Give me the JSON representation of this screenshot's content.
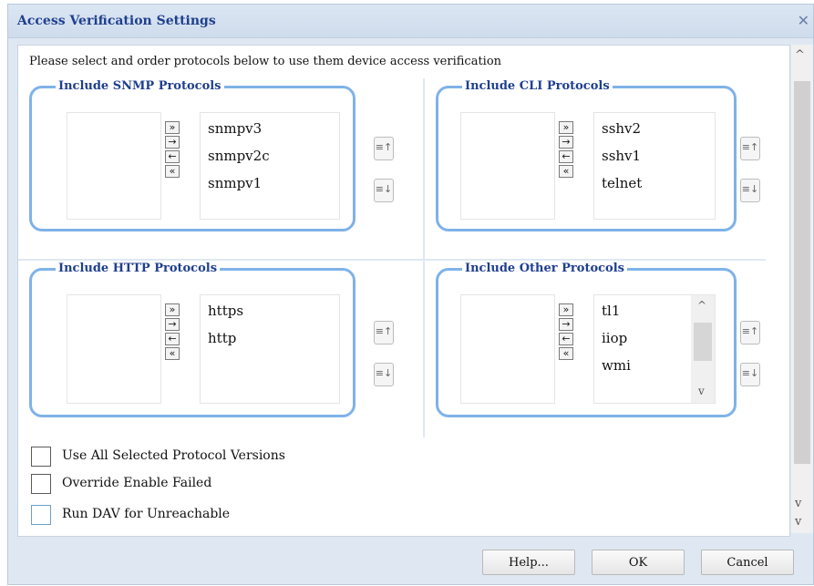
{
  "dialog": {
    "title": "Access Verification Settings",
    "close_glyph": "✕",
    "instruction": "Please select and order protocols below to use them device access verification"
  },
  "panels": {
    "snmp": {
      "label": "Include SNMP Protocols",
      "items": [
        "snmpv3",
        "snmpv2c",
        "snmpv1"
      ]
    },
    "cli": {
      "label": "Include CLI Protocols",
      "items": [
        "sshv2",
        "sshv1",
        "telnet"
      ]
    },
    "http": {
      "label": "Include HTTP Protocols",
      "items": [
        "https",
        "http"
      ]
    },
    "other": {
      "label": "Include Other Protocols",
      "items": [
        "tl1",
        "iiop",
        "wmi"
      ]
    }
  },
  "transfer_buttons": [
    "»",
    "→",
    "←",
    "«"
  ],
  "order_buttons": {
    "up": "≡↑",
    "down": "≡↓"
  },
  "checkboxes": {
    "use_all": "Use All Selected Protocol Versions",
    "override": "Override Enable Failed",
    "run_dav": "Run DAV for Unreachable"
  },
  "buttons": {
    "help": "Help...",
    "ok": "OK",
    "cancel": "Cancel"
  },
  "scroll": {
    "up": "^",
    "down": "v"
  }
}
